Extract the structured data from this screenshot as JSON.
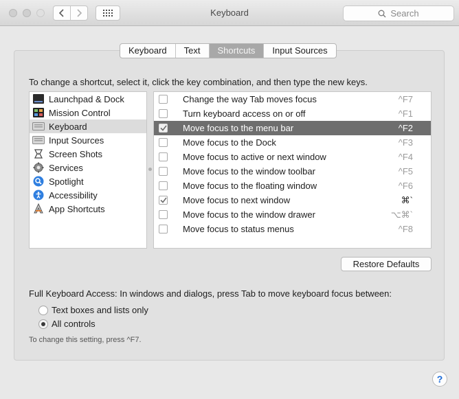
{
  "window": {
    "title": "Keyboard",
    "search_placeholder": "Search"
  },
  "tabs": [
    {
      "label": "Keyboard",
      "active": false
    },
    {
      "label": "Text",
      "active": false
    },
    {
      "label": "Shortcuts",
      "active": true
    },
    {
      "label": "Input Sources",
      "active": false
    }
  ],
  "instruction": "To change a shortcut, select it, click the key combination, and then type the new keys.",
  "categories": [
    {
      "label": "Launchpad & Dock",
      "icon": "launchpad-dock-icon",
      "selected": false
    },
    {
      "label": "Mission Control",
      "icon": "mission-control-icon",
      "selected": false
    },
    {
      "label": "Keyboard",
      "icon": "keyboard-icon",
      "selected": true
    },
    {
      "label": "Input Sources",
      "icon": "input-sources-icon",
      "selected": false
    },
    {
      "label": "Screen Shots",
      "icon": "screen-shots-icon",
      "selected": false
    },
    {
      "label": "Services",
      "icon": "services-gear-icon",
      "selected": false
    },
    {
      "label": "Spotlight",
      "icon": "spotlight-icon",
      "selected": false
    },
    {
      "label": "Accessibility",
      "icon": "accessibility-icon",
      "selected": false
    },
    {
      "label": "App Shortcuts",
      "icon": "app-shortcuts-icon",
      "selected": false
    }
  ],
  "shortcuts": [
    {
      "label": "Change the way Tab moves focus",
      "keys": "^F7",
      "checked": false,
      "selected": false
    },
    {
      "label": "Turn keyboard access on or off",
      "keys": "^F1",
      "checked": false,
      "selected": false
    },
    {
      "label": "Move focus to the menu bar",
      "keys": "^F2",
      "checked": true,
      "selected": true
    },
    {
      "label": "Move focus to the Dock",
      "keys": "^F3",
      "checked": false,
      "selected": false
    },
    {
      "label": "Move focus to active or next window",
      "keys": "^F4",
      "checked": false,
      "selected": false
    },
    {
      "label": "Move focus to the window toolbar",
      "keys": "^F5",
      "checked": false,
      "selected": false
    },
    {
      "label": "Move focus to the floating window",
      "keys": "^F6",
      "checked": false,
      "selected": false
    },
    {
      "label": "Move focus to next window",
      "keys": "⌘`",
      "checked": true,
      "selected": false
    },
    {
      "label": "Move focus to the window drawer",
      "keys": "⌥⌘`",
      "checked": false,
      "selected": false
    },
    {
      "label": "Move focus to status menus",
      "keys": "^F8",
      "checked": false,
      "selected": false
    }
  ],
  "restore_button": "Restore Defaults",
  "full_keyboard_access": {
    "heading": "Full Keyboard Access: In windows and dialogs, press Tab to move keyboard focus between:",
    "options": [
      {
        "label": "Text boxes and lists only",
        "selected": false
      },
      {
        "label": "All controls",
        "selected": true
      }
    ],
    "note": "To change this setting, press ^F7."
  },
  "help_label": "?"
}
